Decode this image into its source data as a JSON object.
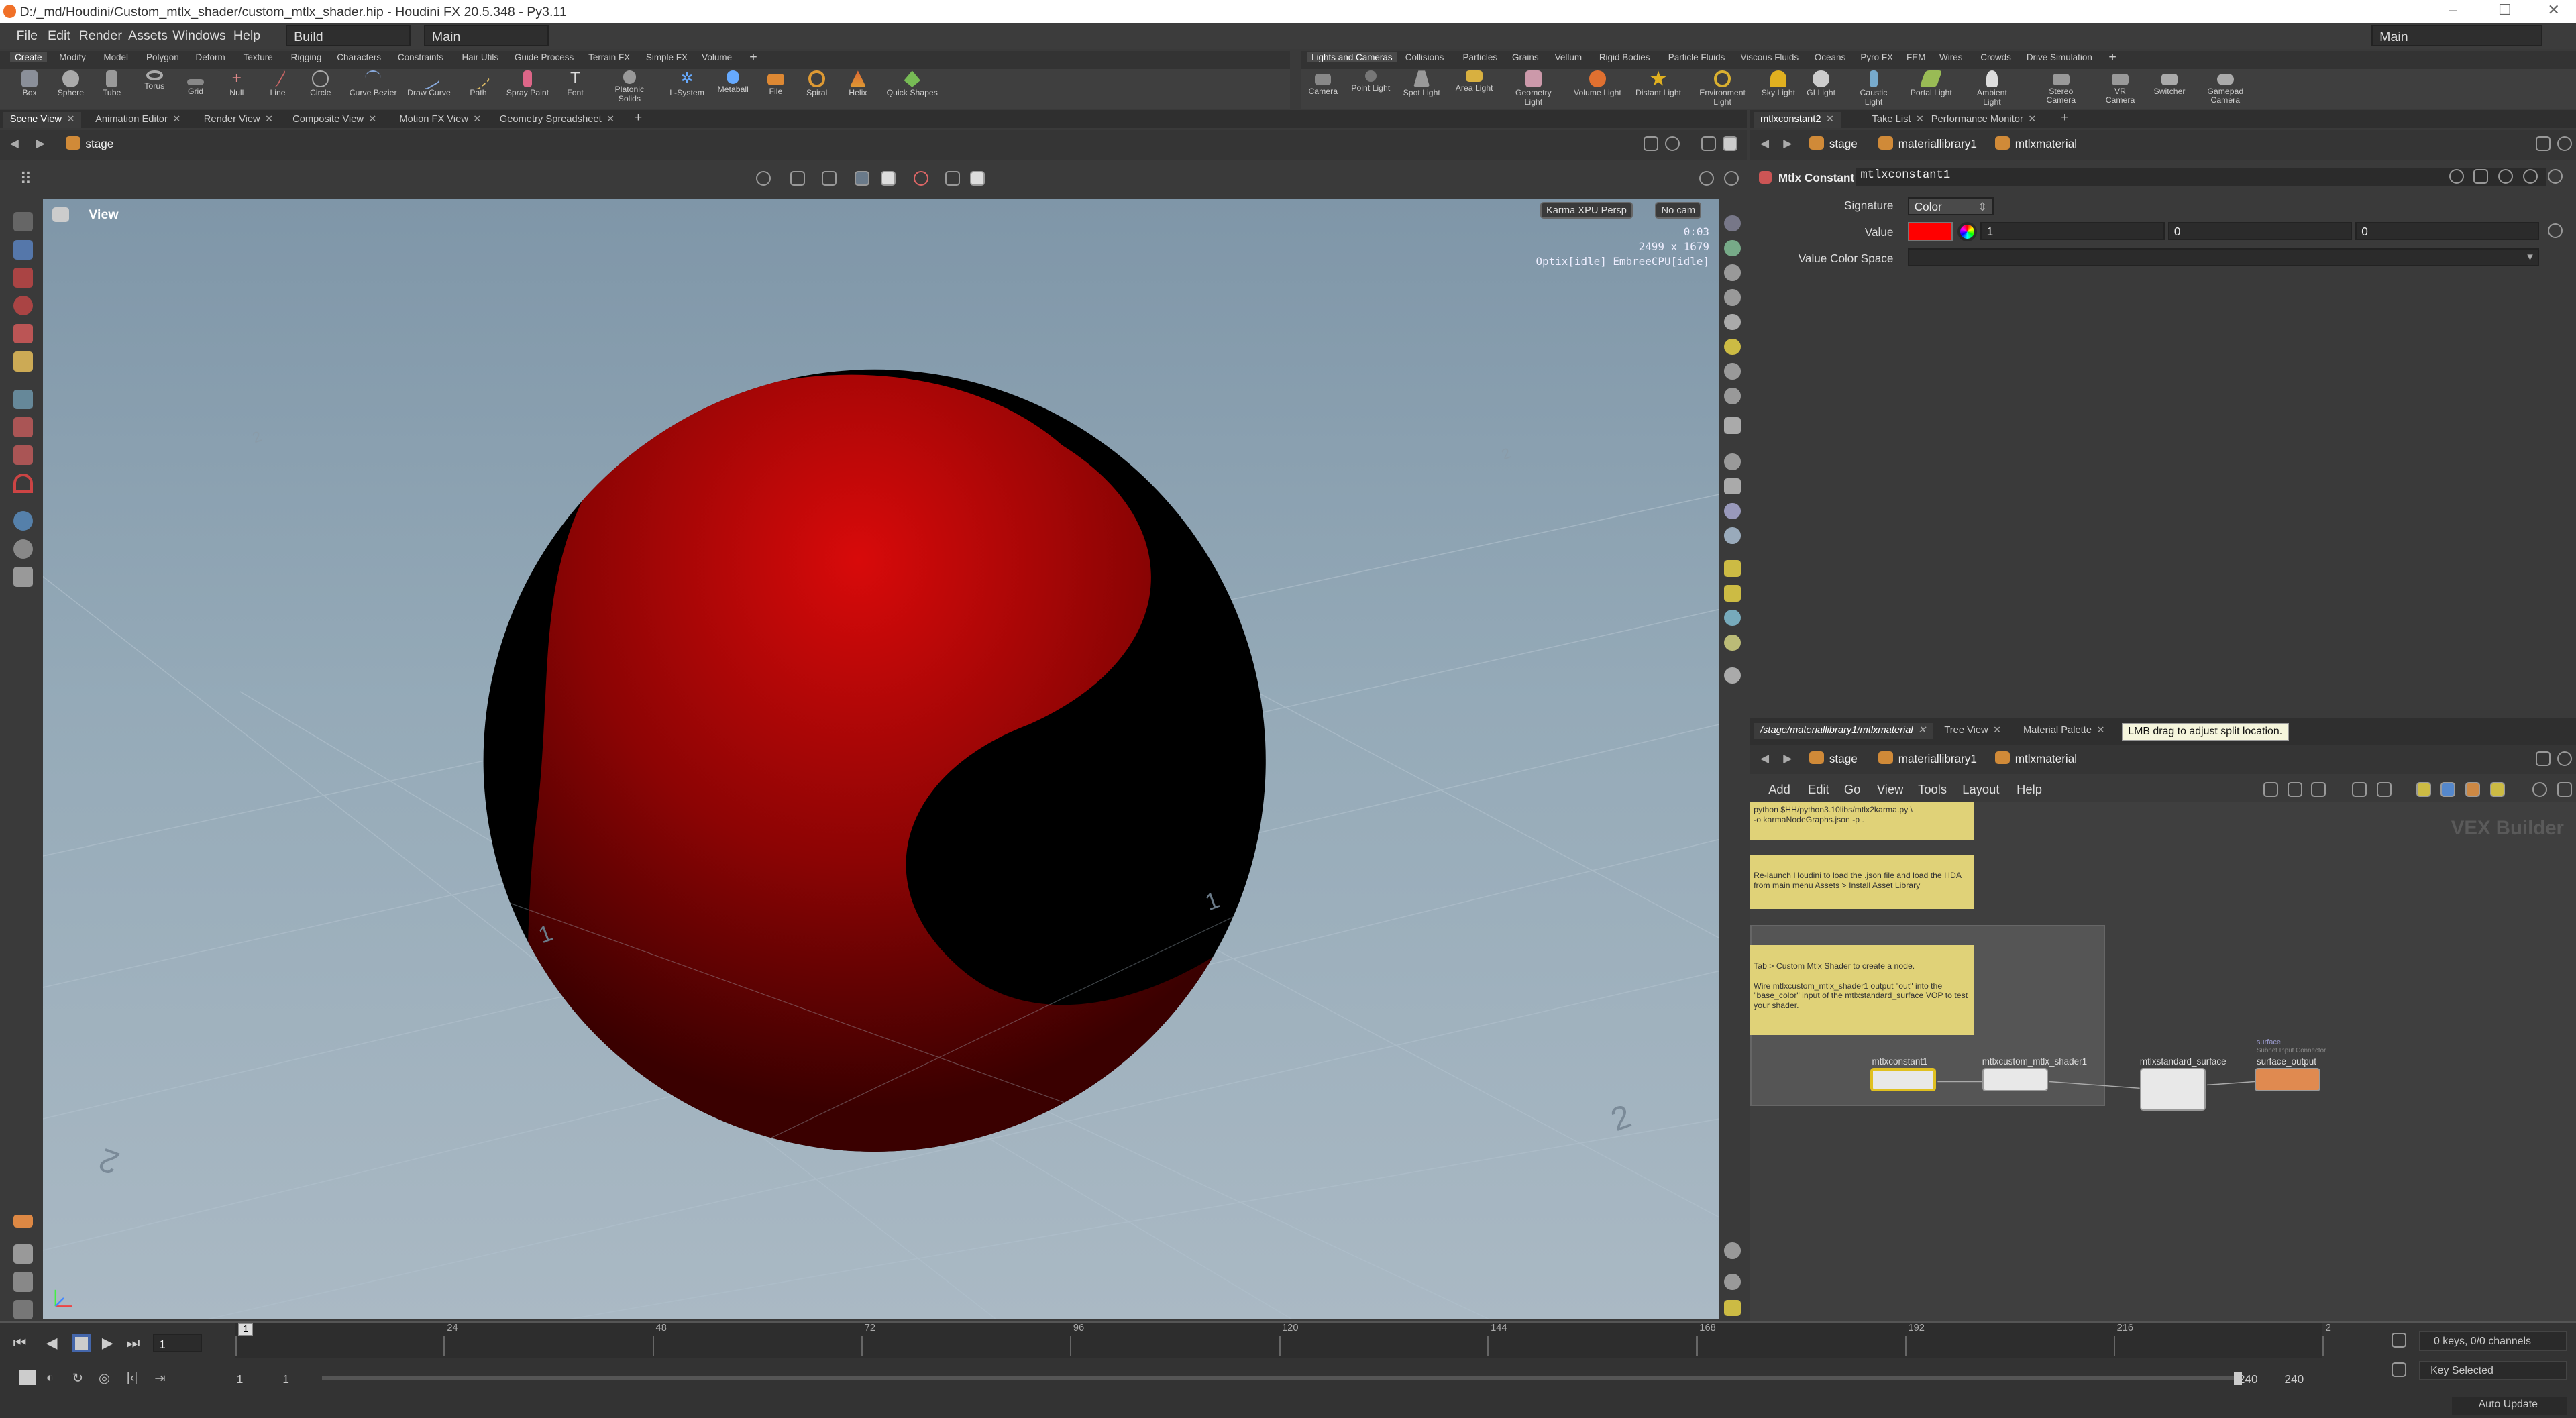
{
  "window": {
    "title": "D:/_md/Houdini/Custom_mtlx_shader/custom_mtlx_shader.hip - Houdini FX 20.5.348 - Py3.11",
    "controls": [
      "–",
      "☐",
      "✕"
    ]
  },
  "menubar": {
    "items": [
      "File",
      "Edit",
      "Render",
      "Assets",
      "Windows",
      "Help"
    ],
    "desktop": "Build",
    "context": "Main",
    "right_desktop": "Main"
  },
  "shelf_left": {
    "tabs": [
      "Create",
      "Modify",
      "Model",
      "Polygon",
      "Deform",
      "Texture",
      "Rigging",
      "Characters",
      "Constraints",
      "Hair Utils",
      "Guide Process",
      "Terrain FX",
      "Simple FX",
      "Volume",
      "+"
    ],
    "tools": [
      "Box",
      "Sphere",
      "Tube",
      "Torus",
      "Grid",
      "Null",
      "Line",
      "Circle",
      "Curve Bezier",
      "Draw Curve",
      "Path",
      "Spray Paint",
      "Font",
      "Platonic Solids",
      "L-System",
      "Metaball",
      "File",
      "Spiral",
      "Helix",
      "Quick Shapes"
    ]
  },
  "shelf_right": {
    "tabs": [
      "Lights and Cameras",
      "Collisions",
      "Particles",
      "Grains",
      "Vellum",
      "Rigid Bodies",
      "Particle Fluids",
      "Viscous Fluids",
      "Oceans",
      "Pyro FX",
      "FEM",
      "Wires",
      "Crowds",
      "Drive Simulation",
      "+"
    ],
    "tools": [
      "Camera",
      "Point Light",
      "Spot Light",
      "Area Light",
      "Geometry Light",
      "Volume Light",
      "Distant Light",
      "Environment Light",
      "Sky Light",
      "GI Light",
      "Caustic Light",
      "Portal Light",
      "Ambient Light",
      "Stereo Camera",
      "VR Camera",
      "Switcher",
      "Gamepad Camera"
    ]
  },
  "viewer": {
    "tabs": [
      "Scene View",
      "Animation Editor",
      "Render View",
      "Composite View",
      "Motion FX View",
      "Geometry Spreadsheet",
      "+"
    ],
    "path": "stage",
    "view_label": "View",
    "renderer": "Karma XPU  Persp",
    "camera": "No cam",
    "stats": [
      "0:03",
      "2499 x 1679",
      "Optix[idle] EmbreeCPU[idle]"
    ],
    "grid_labels": [
      "1",
      "1",
      "2",
      "2",
      "2",
      "2"
    ]
  },
  "timeline": {
    "ticks": [
      "1",
      "24",
      "48",
      "72",
      "96",
      "120",
      "144",
      "168",
      "192",
      "216",
      "2"
    ],
    "current_frame": "1",
    "range_start": "1",
    "range_start2": "1",
    "range_end": "240",
    "range_end2": "240",
    "keys": "0 keys, 0/0 channels",
    "key_selected": "Key Selected",
    "auto_update": "Auto Update"
  },
  "parm_pane": {
    "tabs": [
      "mtlxconstant2",
      "Take List",
      "Performance Monitor",
      "+"
    ],
    "path": [
      "stage",
      "materiallibrary1",
      "mtlxmaterial"
    ],
    "node_type": "Mtlx Constant",
    "node_name": "mtlxconstant1",
    "signature_label": "Signature",
    "signature_value": "Color",
    "value_label": "Value",
    "value_color": "#ff0000",
    "value_r": "1",
    "value_g": "0",
    "value_b": "0",
    "colorspace_label": "Value Color Space",
    "colorspace_value": ""
  },
  "network_pane": {
    "tabs": [
      "/stage/materiallibrary1/mtlxmaterial",
      "Tree View",
      "Material Palette"
    ],
    "tooltip": "LMB drag to adjust split location.",
    "path": [
      "stage",
      "materiallibrary1",
      "mtlxmaterial"
    ],
    "menu": [
      "Add",
      "Edit",
      "Go",
      "View",
      "Tools",
      "Layout",
      "Help"
    ],
    "watermark": "VEX Builder",
    "sticky1": "python $HH/python3.10libs/mtlx2karma.py \\\n-o karmaNodeGraphs.json -p .",
    "sticky2": "Re-launch Houdini to load the .json file and load the HDA from main menu Assets > Install Asset Library",
    "sticky3a": "Tab > Custom Mtlx Shader to create a node.",
    "sticky3b": "Wire mtlxcustom_mtlx_shader1 output \"out\" into the \"base_color\" input of the mtlxstandard_surface VOP to test your shader.",
    "nodes": [
      "mtlxconstant1",
      "mtlxcustom_mtlx_shader1",
      "mtlxstandard_surface",
      "surface_output"
    ],
    "output_tag": "surface",
    "output_tag2": "Subnet Input Connector"
  }
}
